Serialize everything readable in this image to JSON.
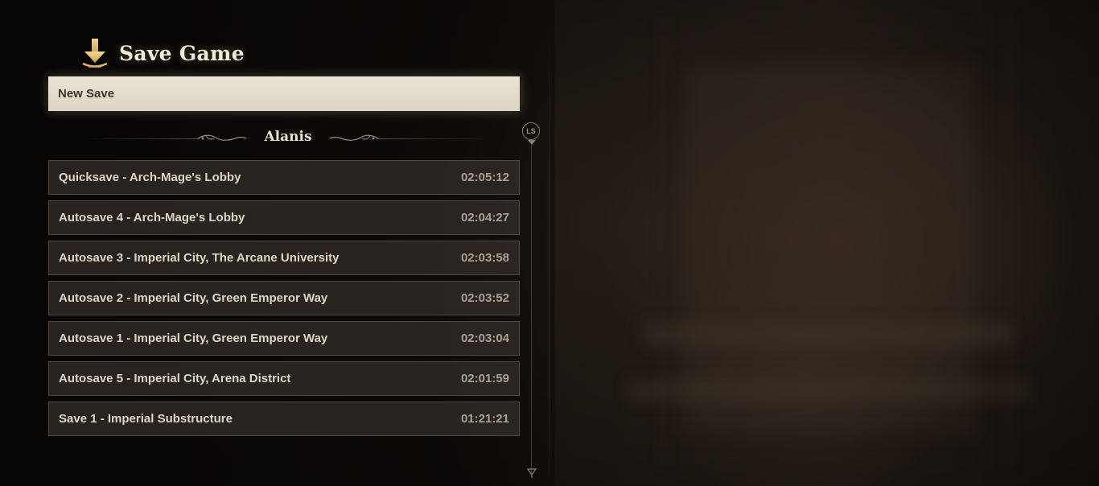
{
  "header": {
    "title": "Save Game",
    "icon": "download-arrow-icon"
  },
  "new_save": {
    "label": "New Save"
  },
  "character": {
    "name": "Alanis"
  },
  "saves": [
    {
      "name": "Quicksave - Arch-Mage's Lobby",
      "time": "02:05:12"
    },
    {
      "name": "Autosave 4 - Arch-Mage's Lobby",
      "time": "02:04:27"
    },
    {
      "name": "Autosave 3 - Imperial City, The Arcane University",
      "time": "02:03:58"
    },
    {
      "name": "Autosave 2 - Imperial City, Green Emperor Way",
      "time": "02:03:52"
    },
    {
      "name": "Autosave 1 - Imperial City, Green Emperor Way",
      "time": "02:03:04"
    },
    {
      "name": "Autosave 5 - Imperial City, Arena District",
      "time": "02:01:59"
    },
    {
      "name": "Save 1 - Imperial Substructure",
      "time": "01:21:21"
    }
  ],
  "scrollbar": {
    "button_label": "LS"
  },
  "colors": {
    "accent_gold": "#d9b46a",
    "text_light": "#ddd6c8",
    "selected_bg": "#ebe4d3"
  }
}
